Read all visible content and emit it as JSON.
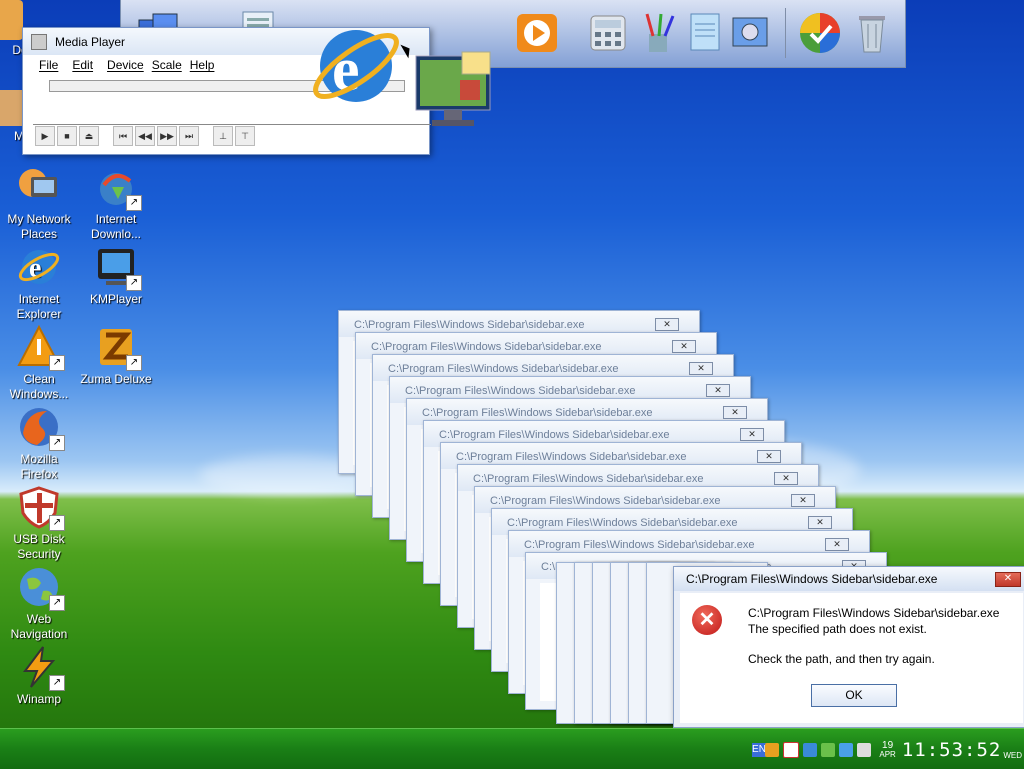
{
  "desktop": {
    "icons": [
      {
        "label": "My Network Places",
        "name": "network-places"
      },
      {
        "label": "Internet Downlo...",
        "name": "internet-download"
      },
      {
        "label": "Internet Explorer",
        "name": "internet-explorer"
      },
      {
        "label": "KMPlayer",
        "name": "kmplayer"
      },
      {
        "label": "Clean Windows...",
        "name": "clean-windows"
      },
      {
        "label": "Zuma Deluxe",
        "name": "zuma-deluxe"
      },
      {
        "label": "Mozilla Firefox",
        "name": "firefox"
      },
      {
        "label": "USB Disk Security",
        "name": "usb-disk-security"
      },
      {
        "label": "Web Navigation",
        "name": "web-navigation"
      },
      {
        "label": "Winamp",
        "name": "winamp"
      }
    ],
    "partial_left_labels": [
      "Do",
      "My"
    ]
  },
  "media_player": {
    "title": "Media Player",
    "menu": [
      "File",
      "Edit",
      "Device",
      "Scale",
      "Help"
    ],
    "controls": [
      "play",
      "stop",
      "eject",
      "previous-track",
      "rewind",
      "fast-forward",
      "next-track",
      "start-selection",
      "end-selection"
    ]
  },
  "ghost_dialogs": {
    "title": "C:\\Program Files\\Windows Sidebar\\sidebar.exe",
    "count": 12
  },
  "error_dialog": {
    "title": "C:\\Program Files\\Windows Sidebar\\sidebar.exe",
    "line1": "C:\\Program Files\\Windows Sidebar\\sidebar.exe",
    "line2": "The specified path does not exist.",
    "line3": "Check the path, and then try again.",
    "ok_label": "OK"
  },
  "taskbar": {
    "language": "EN",
    "date_day": "19",
    "date_month": "APR",
    "weekday": "WED",
    "time": "11:53:52"
  }
}
